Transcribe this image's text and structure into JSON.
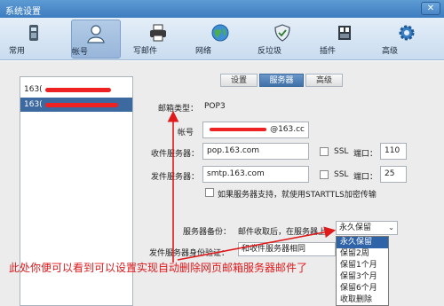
{
  "window": {
    "title": "系统设置",
    "close_label": "✕"
  },
  "toolbar": {
    "items": [
      {
        "label": "常用",
        "icon": "phone-icon"
      },
      {
        "label": "帐号",
        "icon": "user-icon"
      },
      {
        "label": "写邮件",
        "icon": "printer-icon"
      },
      {
        "label": "网络",
        "icon": "globe-icon"
      },
      {
        "label": "反垃圾",
        "icon": "shield-icon"
      },
      {
        "label": "插件",
        "icon": "plugin-icon"
      },
      {
        "label": "高级",
        "icon": "gear-icon"
      }
    ],
    "active": "帐号"
  },
  "accounts": [
    {
      "label": "163("
    },
    {
      "label": "163("
    }
  ],
  "tabs": [
    {
      "label": "设置"
    },
    {
      "label": "服务器"
    },
    {
      "label": "高级"
    }
  ],
  "server": {
    "mailbox_type_label": "邮箱类型：",
    "mailbox_type_value": "POP3",
    "account_label": "帐号",
    "account_value_suffix": "@163.cc",
    "incoming_label": "收件服务器：",
    "incoming_value": "pop.163.com",
    "incoming_ssl_label": "SSL",
    "incoming_port_label": "端口：",
    "incoming_port_value": "110",
    "outgoing_label": "发件服务器：",
    "outgoing_value": "smtp.163.com",
    "outgoing_ssl_label": "SSL",
    "outgoing_port_label": "端口：",
    "outgoing_port_value": "25",
    "starttls_label": "如果服务器支持，就使用STARTTLS加密传输",
    "backup_label": "服务器备份：",
    "backup_desc": "邮件收取后，在服务器上",
    "backup_select_value": "永久保留",
    "auth_label": "发件服务器身份验证：",
    "auth_select_value": "和收件服务器相同"
  },
  "backup_options": [
    "永久保留",
    "保留2周",
    "保留1个月",
    "保留3个月",
    "保留6个月",
    "收取删除"
  ],
  "annotation": "此处你便可以看到可以设置实现自动删除网页邮箱服务器邮件了"
}
